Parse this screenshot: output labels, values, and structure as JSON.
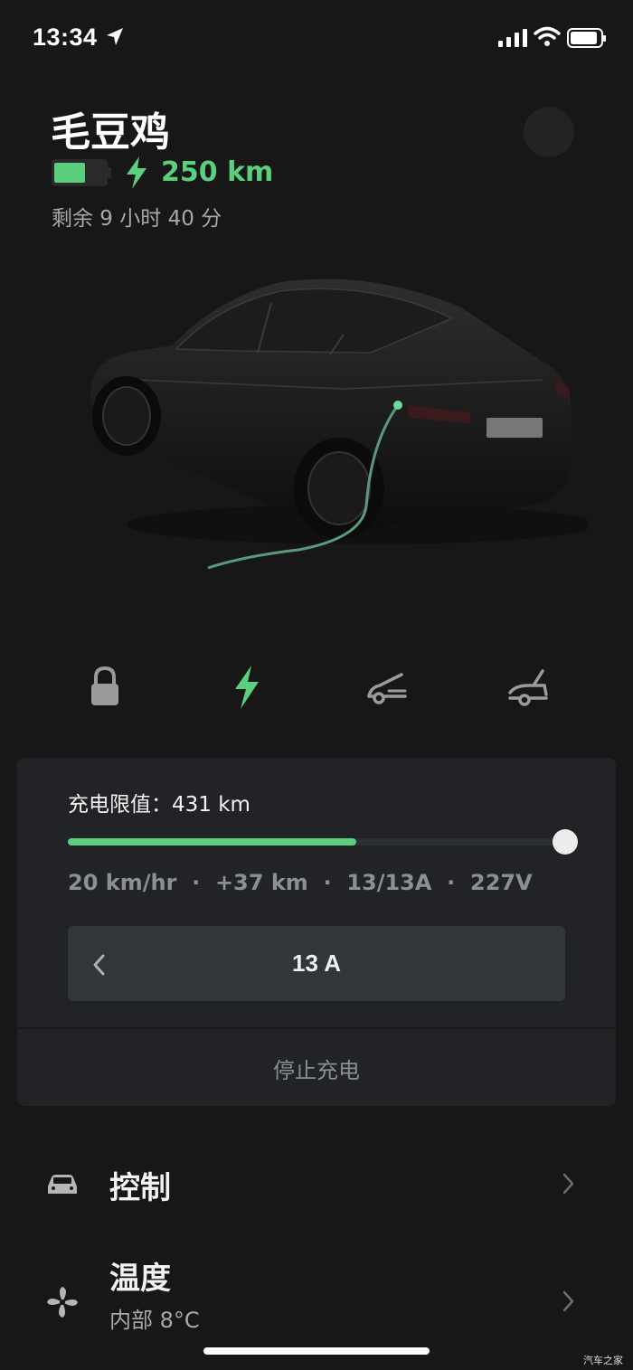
{
  "status_bar": {
    "time": "13:34"
  },
  "header": {
    "car_name": "毛豆鸡",
    "range": "250 km",
    "remaining": "剩余 9 小时 40 分"
  },
  "quick_actions": [
    {
      "name": "lock",
      "icon": "lock-icon"
    },
    {
      "name": "charge",
      "icon": "bolt-icon",
      "active": true
    },
    {
      "name": "frunk",
      "icon": "frunk-icon"
    },
    {
      "name": "trunk",
      "icon": "trunk-icon"
    }
  ],
  "charging": {
    "limit_label": "充电限值：431 km",
    "level": 0.58,
    "stats": "20 km/hr  ·  +37 km  ·  13/13A  ·  227V",
    "amps": "13 A",
    "stop_label": "停止充电"
  },
  "menu": {
    "controls_label": "控制",
    "climate_label": "温度",
    "climate_sub": "内部 8°C"
  },
  "watermark": "汽车之家",
  "colors": {
    "accent": "#5ad07e",
    "background": "#171717",
    "card": "#212326"
  }
}
